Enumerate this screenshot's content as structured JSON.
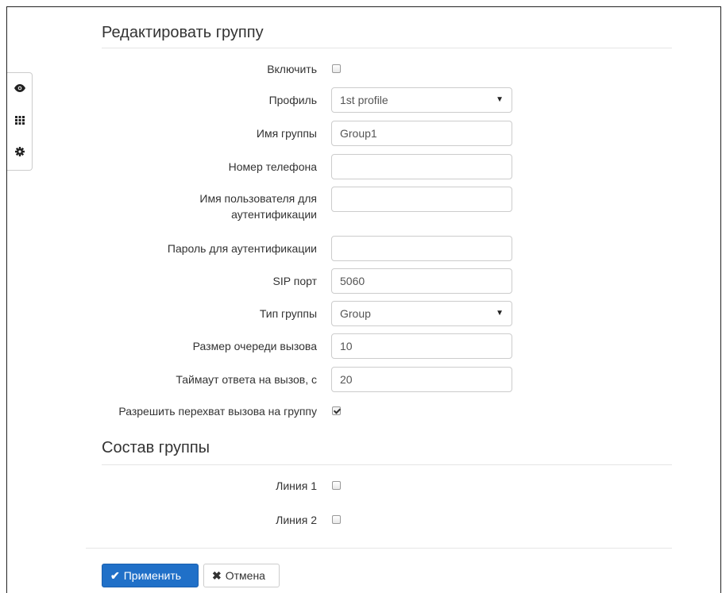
{
  "sections": {
    "edit_group": "Редактировать группу",
    "group_members": "Состав группы"
  },
  "fields": {
    "enable": {
      "label": "Включить",
      "checked": false
    },
    "profile": {
      "label": "Профиль",
      "value": "1st profile"
    },
    "group_name": {
      "label": "Имя группы",
      "value": "Group1"
    },
    "phone_number": {
      "label": "Номер телефона",
      "value": ""
    },
    "auth_user": {
      "label": "Имя пользователя для аутентификации",
      "value": ""
    },
    "auth_password": {
      "label": "Пароль для аутентификации",
      "value": ""
    },
    "sip_port": {
      "label": "SIP порт",
      "value": "5060"
    },
    "group_type": {
      "label": "Тип группы",
      "value": "Group"
    },
    "queue_size": {
      "label": "Размер очереди вызова",
      "value": "10"
    },
    "answer_timeout": {
      "label": "Таймаут ответа на вызов, с",
      "value": "20"
    },
    "call_pickup": {
      "label": "Разрешить перехват вызова на группу",
      "checked": true
    }
  },
  "lines": [
    {
      "label": "Линия 1",
      "checked": false
    },
    {
      "label": "Линия 2",
      "checked": false
    }
  ],
  "buttons": {
    "apply": "Применить",
    "cancel": "Отмена"
  },
  "icons": {
    "side": [
      "eye-icon",
      "grid-icon",
      "gear-icon"
    ],
    "apply": "check-icon",
    "cancel": "times-icon"
  },
  "colors": {
    "primary": "#2070c8",
    "border": "#cccccc"
  }
}
